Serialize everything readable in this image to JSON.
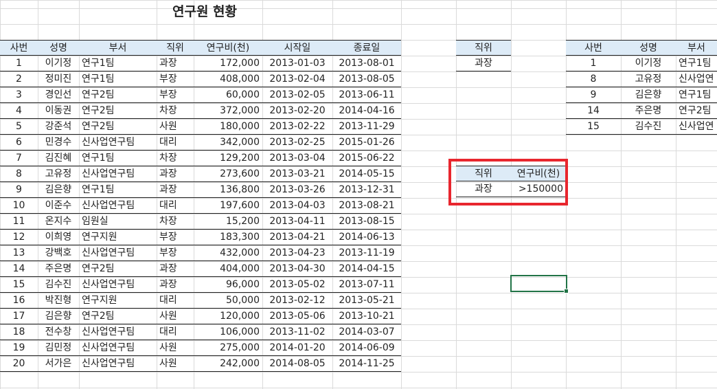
{
  "sheet_title": "연구원 현황",
  "main_table": {
    "headers": [
      "사번",
      "성명",
      "부서",
      "직위",
      "연구비(천)",
      "시작일",
      "종료일"
    ],
    "rows": [
      [
        "1",
        "이기정",
        "연구1팀",
        "과장",
        "172,000",
        "2013-01-03",
        "2013-08-01"
      ],
      [
        "2",
        "정미진",
        "연구1팀",
        "부장",
        "408,000",
        "2013-02-04",
        "2013-08-05"
      ],
      [
        "3",
        "경인선",
        "연구2팀",
        "부장",
        "60,000",
        "2013-02-05",
        "2013-06-11"
      ],
      [
        "4",
        "이동권",
        "연구2팀",
        "차장",
        "372,000",
        "2013-02-20",
        "2014-04-16"
      ],
      [
        "5",
        "강준석",
        "연구2팀",
        "사원",
        "180,000",
        "2013-02-22",
        "2013-11-29"
      ],
      [
        "6",
        "민경수",
        "신사업연구팀",
        "대리",
        "342,000",
        "2013-02-25",
        "2015-01-26"
      ],
      [
        "7",
        "김진혜",
        "연구1팀",
        "차장",
        "129,200",
        "2013-03-04",
        "2015-06-22"
      ],
      [
        "8",
        "고유정",
        "신사업연구팀",
        "과장",
        "273,600",
        "2013-03-21",
        "2014-05-15"
      ],
      [
        "9",
        "김은향",
        "연구1팀",
        "과장",
        "136,800",
        "2013-03-26",
        "2013-12-31"
      ],
      [
        "10",
        "이준수",
        "신사업연구팀",
        "대리",
        "197,600",
        "2013-04-03",
        "2013-08-21"
      ],
      [
        "11",
        "온지수",
        "임원실",
        "차장",
        "15,200",
        "2013-04-11",
        "2013-08-15"
      ],
      [
        "12",
        "이희영",
        "연구지원",
        "부장",
        "183,300",
        "2013-04-21",
        "2014-06-13"
      ],
      [
        "13",
        "강백호",
        "신사업연구팀",
        "부장",
        "432,000",
        "2013-04-23",
        "2013-11-19"
      ],
      [
        "14",
        "주은명",
        "연구2팀",
        "과장",
        "404,000",
        "2013-04-30",
        "2014-04-15"
      ],
      [
        "15",
        "김수진",
        "신사업연구팀",
        "과장",
        "96,000",
        "2013-05-02",
        "2013-07-11"
      ],
      [
        "16",
        "박진형",
        "연구지원",
        "대리",
        "50,000",
        "2013-02-12",
        "2013-05-21"
      ],
      [
        "17",
        "김은향",
        "연구2팀",
        "사원",
        "120,000",
        "2013-05-06",
        "2013-10-21"
      ],
      [
        "18",
        "전수창",
        "신사업연구팀",
        "대리",
        "106,000",
        "2013-11-02",
        "2014-03-07"
      ],
      [
        "19",
        "김민정",
        "신사업연구팀",
        "사원",
        "275,000",
        "2014-01-20",
        "2014-06-09"
      ],
      [
        "20",
        "서가은",
        "신사업연구팀",
        "사원",
        "242,000",
        "2014-08-05",
        "2014-11-25"
      ]
    ]
  },
  "criteria1": {
    "header": "직위",
    "value": "과장"
  },
  "criteria2": {
    "headers": [
      "직위",
      "연구비(천)"
    ],
    "values": [
      "과장",
      ">150000"
    ]
  },
  "result_table": {
    "headers": [
      "사번",
      "성명",
      "부서"
    ],
    "rows": [
      [
        "1",
        "이기정",
        "연구1팀"
      ],
      [
        "8",
        "고유정",
        "신사업연"
      ],
      [
        "9",
        "김은향",
        "연구1팀"
      ],
      [
        "14",
        "주은명",
        "연구2팀"
      ],
      [
        "15",
        "김수진",
        "신사업연"
      ]
    ]
  },
  "colors": {
    "header_fill": "#ddebf7",
    "highlight_border": "#e8262e",
    "selection_border": "#217346"
  }
}
